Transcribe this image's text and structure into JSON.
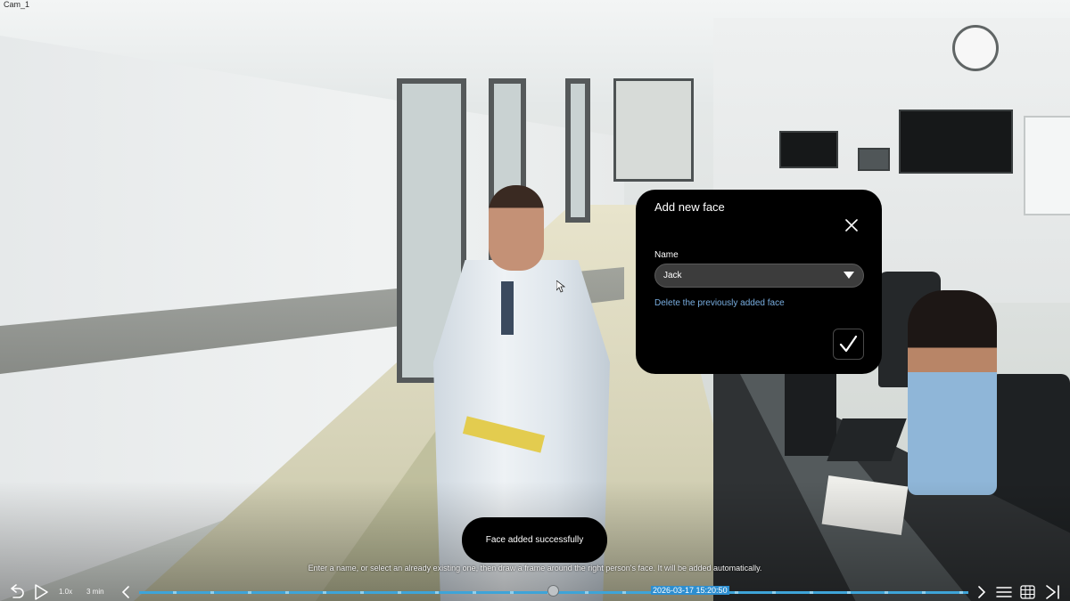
{
  "camera": {
    "label": "Cam_1"
  },
  "dialog": {
    "title": "Add new face",
    "name_label": "Name",
    "name_value": "Jack",
    "delete_link": "Delete the previously added face"
  },
  "toast": {
    "text": "Face added successfully"
  },
  "hint": {
    "text": "Enter a name, or select an already existing one, then draw a frame around the right person's face. It will be added automatically."
  },
  "playback": {
    "speed": "1.0x",
    "span": "3 min",
    "timestamp": "2026-03-17 15:20:50"
  },
  "icons": {
    "undo": "undo-icon",
    "play": "play-icon",
    "previous": "chevron-left-icon",
    "next": "chevron-right-icon",
    "list": "list-icon",
    "grid": "grid-icon",
    "end": "skip-to-end-icon",
    "close": "close-icon",
    "confirm": "checkmark-icon",
    "dropdown": "caret-down-icon"
  },
  "colors": {
    "dialog_bg": "#000000",
    "link": "#79aee0",
    "timeline": "#3ea4d8",
    "timestamp_bg": "#2d8ed0"
  }
}
